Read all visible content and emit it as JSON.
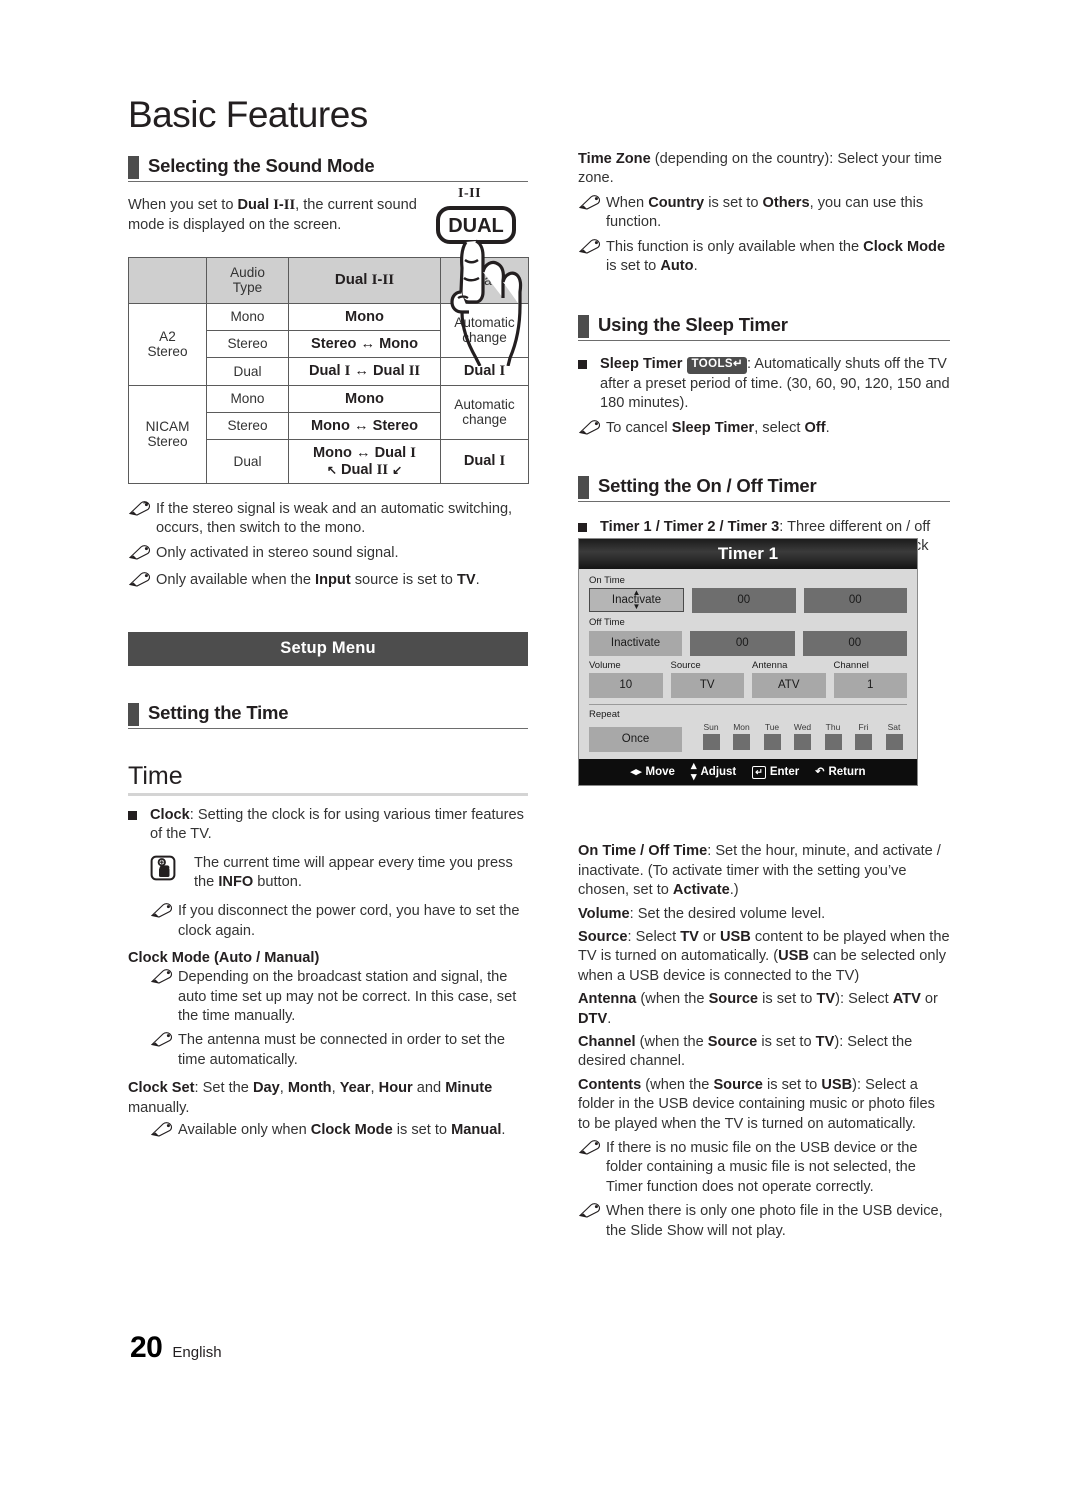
{
  "page": {
    "title": "Basic Features",
    "footer_number": "20",
    "footer_language": "English"
  },
  "left": {
    "sound_mode": {
      "heading": "Selecting the Sound Mode",
      "intro_a": "When you set to ",
      "intro_b": "Dual I-II",
      "intro_c": ", the current sound mode is displayed on the screen.",
      "remote_key_label": "I-II",
      "remote_key_text": "DUAL"
    },
    "audio_table": {
      "headers": [
        "",
        "Audio Type",
        "Dual I-II",
        "Default"
      ],
      "rows": [
        {
          "group": "A2 Stereo",
          "type": "Mono",
          "dual": "Mono",
          "default": "Automatic change"
        },
        {
          "group": "A2 Stereo",
          "type": "Stereo",
          "dual": "Stereo ↔ Mono",
          "default": "Automatic change"
        },
        {
          "group": "A2 Stereo",
          "type": "Dual",
          "dual": "Dual I ↔ Dual II",
          "default": "Dual I"
        },
        {
          "group": "NICAM Stereo",
          "type": "Mono",
          "dual": "Mono",
          "default": "Automatic change"
        },
        {
          "group": "NICAM Stereo",
          "type": "Stereo",
          "dual": "Mono ↔ Stereo",
          "default": "Automatic change"
        },
        {
          "group": "NICAM Stereo",
          "type": "Dual",
          "dual": "Mono ↔ Dual I  ↖ Dual II ↙",
          "default": "Dual I"
        }
      ],
      "group_a2": "A2 Stereo",
      "group_nicam": "NICAM Stereo",
      "cell_audio_type": "Audio Type",
      "cell_default": "Default",
      "mono": "Mono",
      "stereo": "Stereo",
      "dual": "Dual",
      "automatic_change": "Automatic change"
    },
    "notes": [
      "If the stereo signal is weak and an automatic switching, occurs, then switch to the mono.",
      "Only activated in stereo sound signal.",
      "Only available when the Input source is set to TV."
    ],
    "setup_menu_banner": "Setup Menu",
    "setting_time_heading": "Setting the Time",
    "time_heading": "Time",
    "clock_bullet_label": "Clock",
    "clock_bullet_text": ": Setting the clock is for using various timer features of the TV.",
    "info_note_a": "The current time will appear every time you press the ",
    "info_note_b": "INFO",
    "info_note_c": " button.",
    "power_cord_note": "If you disconnect the power cord, you have to set the clock again.",
    "clock_mode_subhead": "Clock Mode (Auto / Manual)",
    "clock_mode_note1": "Depending on the broadcast station and signal, the auto time set up may not be correct. In this case, set the time manually.",
    "clock_mode_note2": "The antenna must be connected in order to set the time automatically.",
    "clock_set_label": "Clock Set",
    "clock_set_text_a": ": Set the ",
    "clock_set_day": "Day",
    "clock_set_month": "Month",
    "clock_set_year": "Year",
    "clock_set_hour": "Hour",
    "clock_set_minute": "Minute",
    "clock_set_text_b": " manually.",
    "clock_set_note_a": "Available only when ",
    "clock_set_note_b": "Clock Mode",
    "clock_set_note_c": " is set to ",
    "clock_set_note_d": "Manual",
    "clock_set_note_e": "."
  },
  "right": {
    "time_zone_label": "Time Zone",
    "time_zone_text": " (depending on the country): Select your time zone.",
    "time_zone_note1_a": "When ",
    "time_zone_note1_b": "Country",
    "time_zone_note1_c": " is set to ",
    "time_zone_note1_d": "Others",
    "time_zone_note1_e": ", you can use this function.",
    "time_zone_note2_a": "This function is only available when the ",
    "time_zone_note2_b": "Clock Mode",
    "time_zone_note2_c": " is set to ",
    "time_zone_note2_d": "Auto",
    "time_zone_note2_e": ".",
    "sleep_timer_heading": "Using the Sleep Timer",
    "sleep_timer_label": "Sleep Timer",
    "tools_chip": "TOOLS",
    "sleep_timer_text": ": Automatically shuts off the TV after a preset period of time. (30, 60, 90, 120, 150 and 180 minutes).",
    "sleep_timer_note_a": "To cancel ",
    "sleep_timer_note_b": "Sleep Timer",
    "sleep_timer_note_c": ", select ",
    "sleep_timer_note_d": "Off",
    "sleep_timer_note_e": ".",
    "onoff_timer_heading": "Setting the On / Off Timer",
    "timers_label": "Timer 1 / Timer 2 / Timer 3",
    "timers_text": ": Three different on / off timer settings can be made. You must set the clock first.",
    "desc": {
      "ontime_label": "On Time / Off Time",
      "ontime_text_a": ": Set the hour, minute, and activate / inactivate. (To activate timer with the setting you’ve chosen, set to ",
      "ontime_activate": "Activate",
      "ontime_text_b": ".)",
      "volume_label": "Volume",
      "volume_text": ": Set the desired volume level.",
      "source_label": "Source",
      "source_text_a": ": Select ",
      "source_tv": "TV",
      "source_text_b": " or ",
      "source_usb": "USB",
      "source_text_c": " content to be played when the TV is turned on automatically. (",
      "source_usb2": "USB",
      "source_text_d": " can be selected only when a USB device is connected to the TV)",
      "antenna_label": "Antenna",
      "antenna_text_a": " (when the ",
      "antenna_source": "Source",
      "antenna_text_b": " is set to ",
      "antenna_tv": "TV",
      "antenna_text_c": "): Select ",
      "antenna_atv": "ATV",
      "antenna_text_d": " or ",
      "antenna_dtv": "DTV",
      "antenna_text_e": ".",
      "channel_label": "Channel",
      "channel_text_a": " (when the ",
      "channel_source": "Source",
      "channel_text_b": " is set to ",
      "channel_tv": "TV",
      "channel_text_c": "): Select the desired channel.",
      "contents_label": "Contents",
      "contents_text_a": " (when the ",
      "contents_source": "Source",
      "contents_text_b": " is set to ",
      "contents_usb": "USB",
      "contents_text_c": "): Select a folder in the USB device containing music or photo files to be played when the TV is turned on automatically.",
      "note1": "If there is no music file on the USB device or the folder containing a music file is not selected, the Timer function does not operate correctly.",
      "note2": "When there is only one photo file in the USB device, the Slide Show will not play."
    }
  },
  "osd": {
    "title": "Timer 1",
    "on_time_label": "On Time",
    "on_time_state": "Inactivate",
    "on_time_hour": "00",
    "on_time_minute": "00",
    "off_time_label": "Off Time",
    "off_time_state": "Inactivate",
    "off_time_hour": "00",
    "off_time_minute": "00",
    "volume_label": "Volume",
    "volume_value": "10",
    "source_label": "Source",
    "source_value": "TV",
    "antenna_label": "Antenna",
    "antenna_value": "ATV",
    "channel_label": "Channel",
    "channel_value": "1",
    "repeat_label": "Repeat",
    "repeat_value": "Once",
    "days": [
      "Sun",
      "Mon",
      "Tue",
      "Wed",
      "Thu",
      "Fri",
      "Sat"
    ],
    "footer": {
      "move": "Move",
      "adjust": "Adjust",
      "enter": "Enter",
      "return": "Return"
    }
  },
  "colors": {
    "accent_bar": "#4d4d4d",
    "table_header": "#cfcfcf",
    "osd_bg": "#d9d9d9",
    "osd_field": "#a8a8a8",
    "osd_field_dark": "#6e6e6e"
  }
}
